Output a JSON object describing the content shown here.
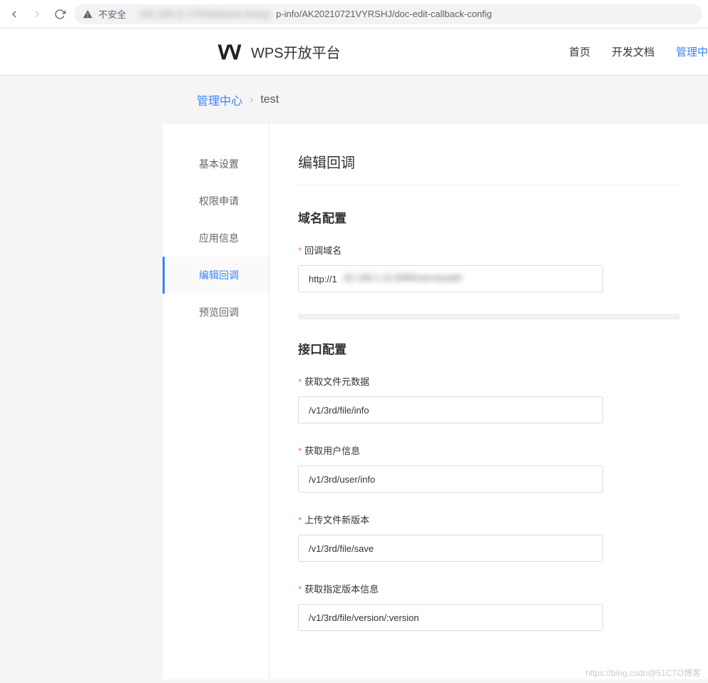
{
  "browser": {
    "insecure_label": "不安全",
    "url_hidden": "192.168.11.175/webopen.ksopp",
    "url_visible": "p-info/AK20210721VYRSHJ/doc-edit-callback-config"
  },
  "header": {
    "brand": "WPS开放平台",
    "nav": {
      "home": "首页",
      "docs": "开发文档",
      "admin": "管理中"
    }
  },
  "breadcrumb": {
    "link": "管理中心",
    "current": "test"
  },
  "sidebar": {
    "items": [
      {
        "label": "基本设置",
        "key": "basic"
      },
      {
        "label": "权限申请",
        "key": "perm"
      },
      {
        "label": "应用信息",
        "key": "appinfo"
      },
      {
        "label": "编辑回调",
        "key": "edit-callback",
        "active": true
      },
      {
        "label": "预览回调",
        "key": "preview-callback"
      }
    ]
  },
  "content": {
    "page_title": "编辑回调",
    "domain_section_title": "域名配置",
    "api_section_title": "接口配置",
    "fields": {
      "callback_domain": {
        "label": "回调域名",
        "value": "http://1",
        "blur_tail": "92.168.1.21:8080/serverpath"
      },
      "file_info": {
        "label": "获取文件元数据",
        "value": "/v1/3rd/file/info"
      },
      "user_info": {
        "label": "获取用户信息",
        "value": "/v1/3rd/user/info"
      },
      "file_save": {
        "label": "上传文件新版本",
        "value": "/v1/3rd/file/save"
      },
      "file_version": {
        "label": "获取指定版本信息",
        "value": "/v1/3rd/file/version/:version"
      }
    }
  },
  "watermark": "https://blog.csdn@51CTO博客"
}
